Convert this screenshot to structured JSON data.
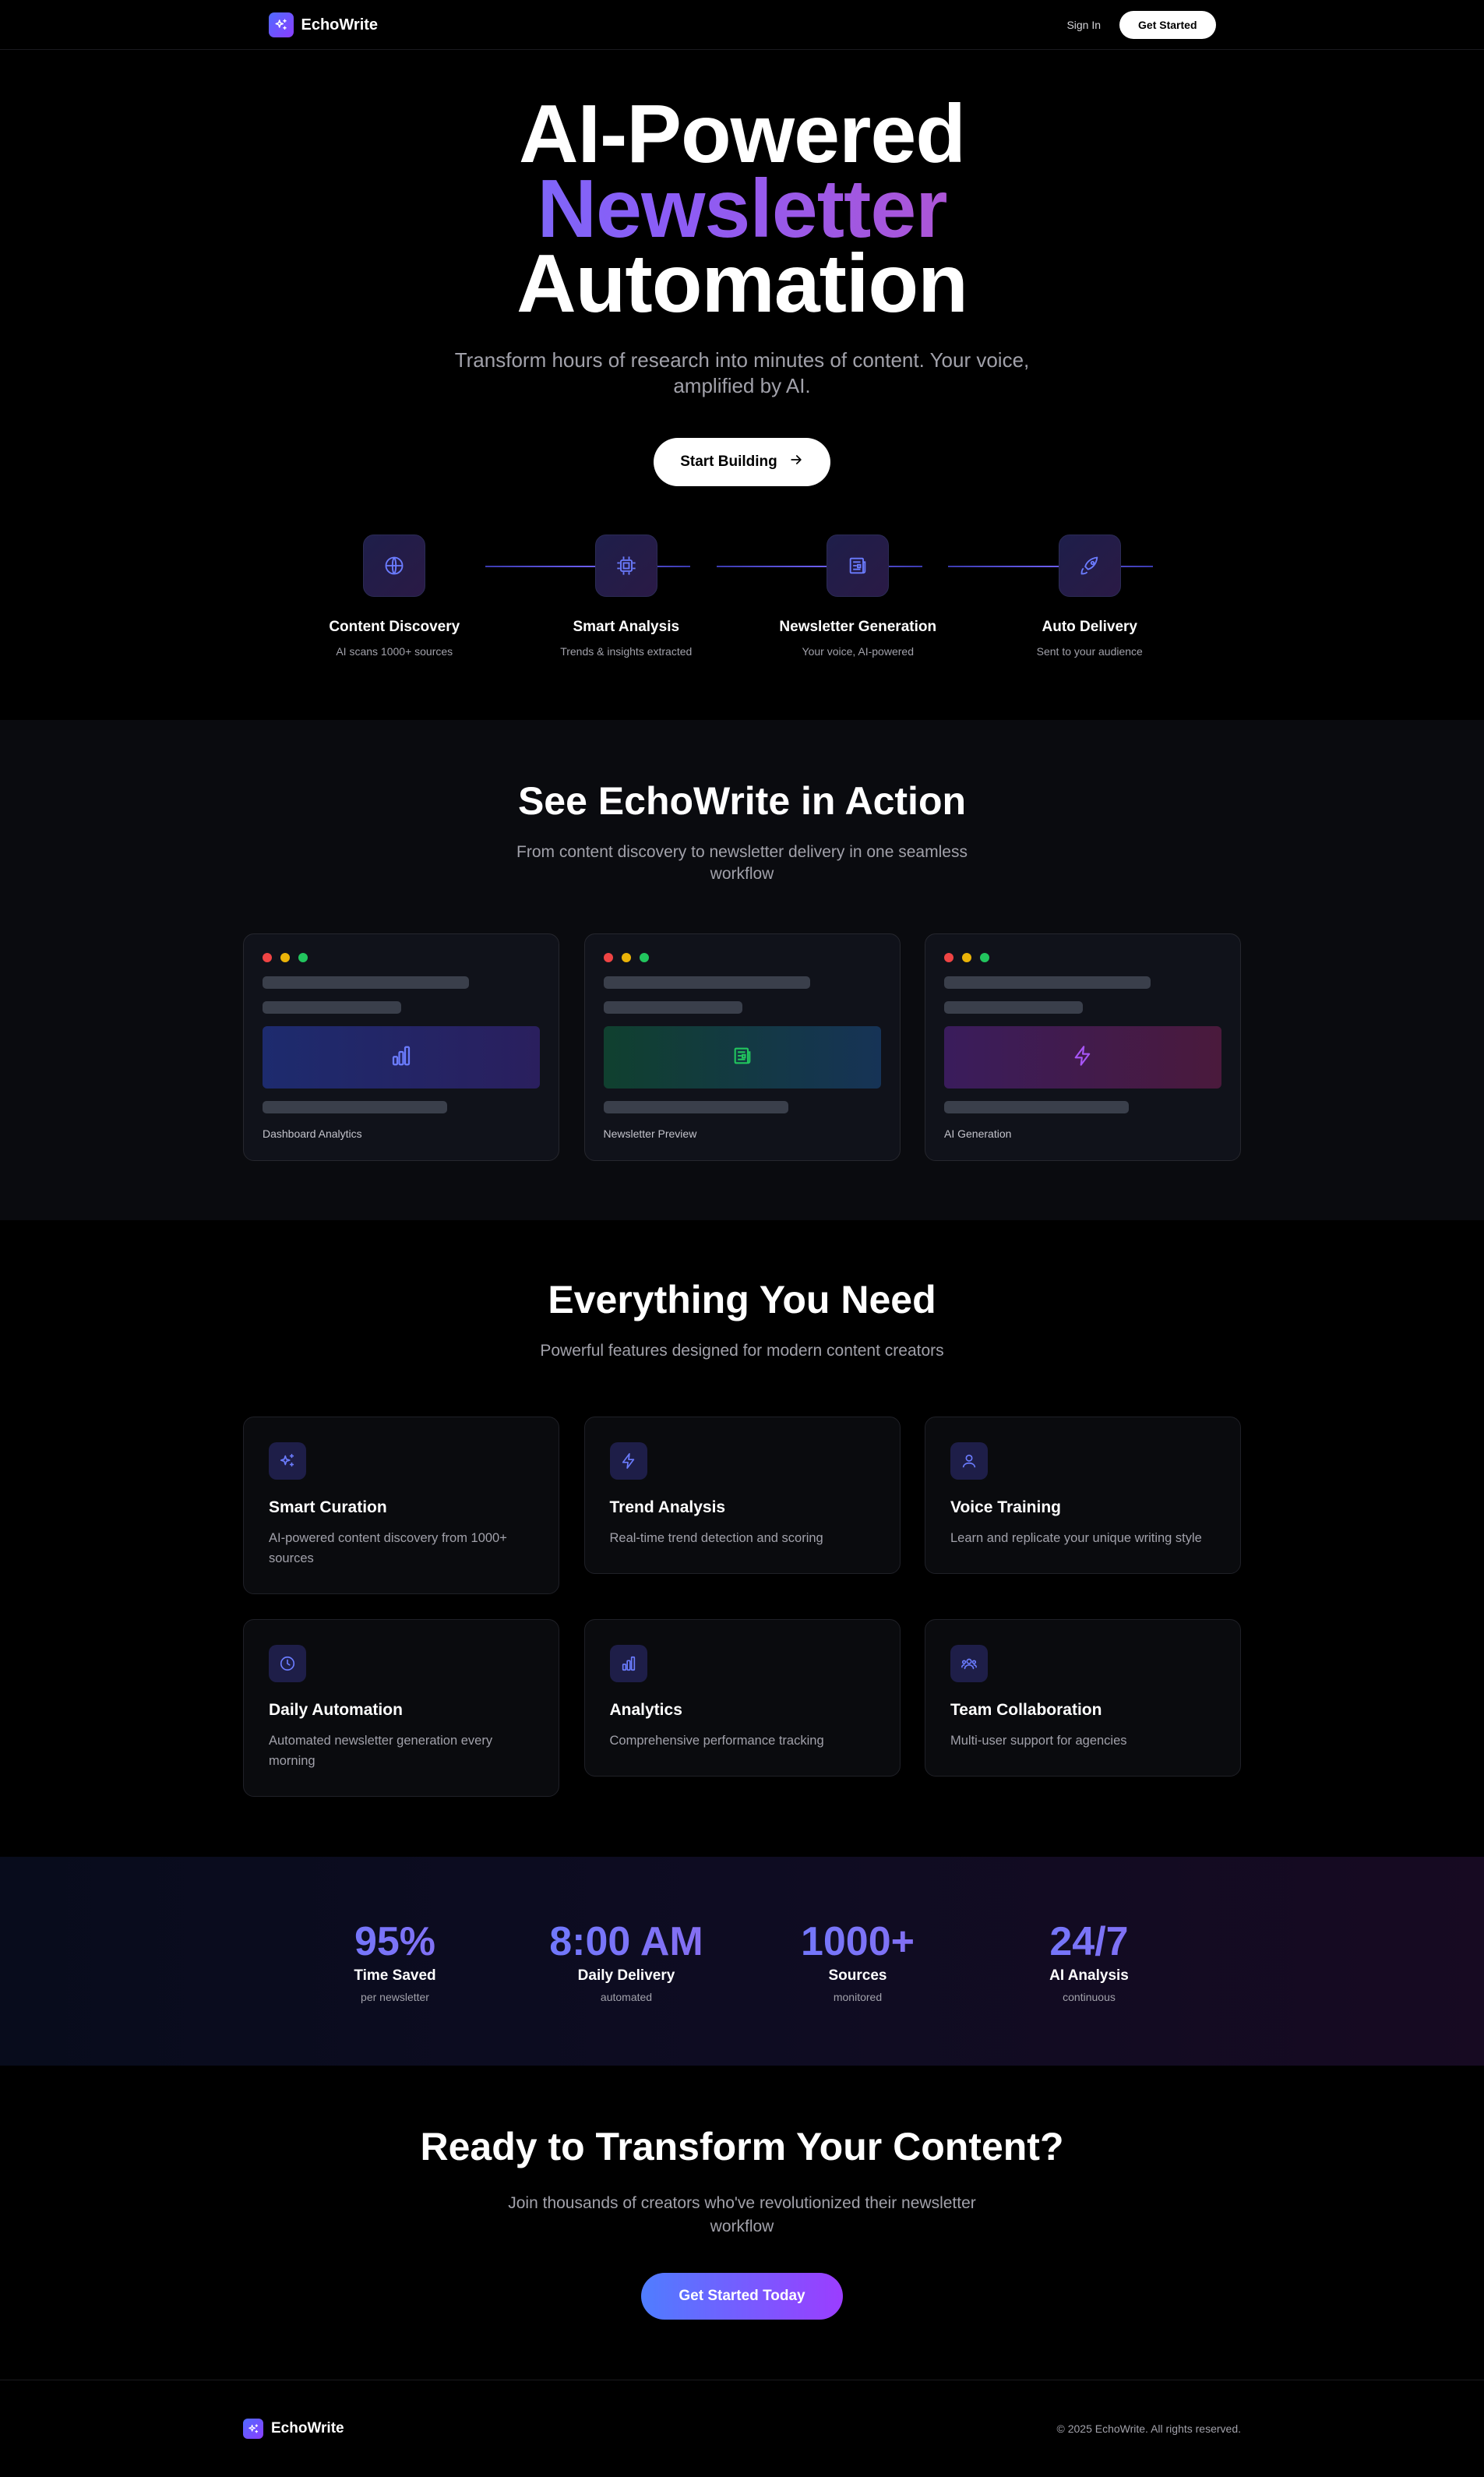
{
  "nav": {
    "brand": "EchoWrite",
    "signin": "Sign In",
    "get_started": "Get Started"
  },
  "hero": {
    "line1": "AI-Powered",
    "line2": "Newsletter",
    "line3": "Automation",
    "subtitle": "Transform hours of research into minutes of content. Your voice, amplified by AI.",
    "cta": "Start Building",
    "steps": [
      {
        "icon": "globe-icon",
        "title": "Content Discovery",
        "sub": "AI scans 1000+ sources"
      },
      {
        "icon": "cpu-icon",
        "title": "Smart Analysis",
        "sub": "Trends & insights extracted"
      },
      {
        "icon": "newspaper-icon",
        "title": "Newsletter Generation",
        "sub": "Your voice, AI-powered"
      },
      {
        "icon": "rocket-icon",
        "title": "Auto Delivery",
        "sub": "Sent to your audience"
      }
    ]
  },
  "action": {
    "title": "See EchoWrite in Action",
    "subtitle": "From content discovery to newsletter delivery in one seamless workflow",
    "cards": [
      {
        "label": "Dashboard Analytics",
        "icon": "bar-chart-icon"
      },
      {
        "label": "Newsletter Preview",
        "icon": "newspaper-icon"
      },
      {
        "label": "AI Generation",
        "icon": "lightning-icon"
      }
    ]
  },
  "features": {
    "title": "Everything You Need",
    "subtitle": "Powerful features designed for modern content creators",
    "items": [
      {
        "icon": "sparkles-icon",
        "title": "Smart Curation",
        "desc": "AI-powered content discovery from 1000+ sources"
      },
      {
        "icon": "lightning-icon",
        "title": "Trend Analysis",
        "desc": "Real-time trend detection and scoring"
      },
      {
        "icon": "user-icon",
        "title": "Voice Training",
        "desc": "Learn and replicate your unique writing style"
      },
      {
        "icon": "clock-icon",
        "title": "Daily Automation",
        "desc": "Automated newsletter generation every morning"
      },
      {
        "icon": "bar-chart-icon",
        "title": "Analytics",
        "desc": "Comprehensive performance tracking"
      },
      {
        "icon": "team-icon",
        "title": "Team Collaboration",
        "desc": "Multi-user support for agencies"
      }
    ]
  },
  "stats": [
    {
      "value": "95%",
      "label": "Time Saved",
      "sub": "per newsletter"
    },
    {
      "value": "8:00 AM",
      "label": "Daily Delivery",
      "sub": "automated"
    },
    {
      "value": "1000+",
      "label": "Sources",
      "sub": "monitored"
    },
    {
      "value": "24/7",
      "label": "AI Analysis",
      "sub": "continuous"
    }
  ],
  "cta": {
    "title": "Ready to Transform Your Content?",
    "subtitle": "Join thousands of creators who've revolutionized their newsletter workflow",
    "button": "Get Started Today"
  },
  "footer": {
    "brand": "EchoWrite",
    "copyright": "© 2025 EchoWrite. All rights reserved."
  },
  "colors": {
    "accent_blue": "#4f7dff",
    "accent_purple": "#8b5cf6",
    "accent_pink": "#ec4899",
    "dot_red": "#ef4444",
    "dot_yellow": "#eab308",
    "dot_green": "#22c55e"
  }
}
